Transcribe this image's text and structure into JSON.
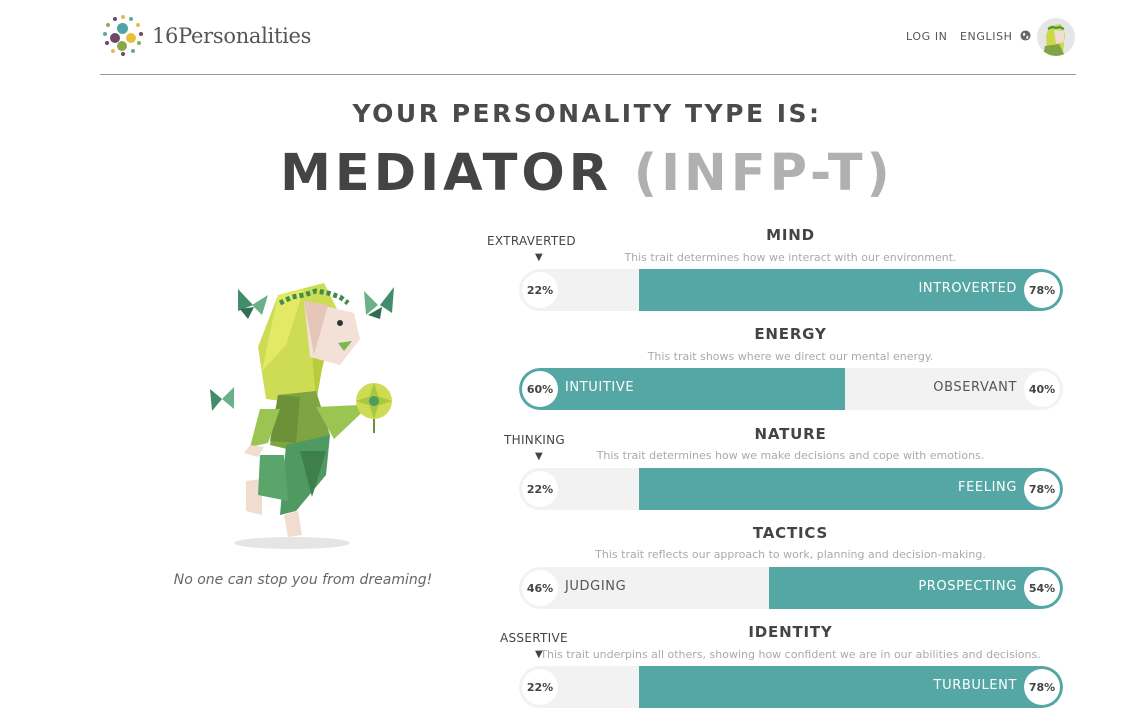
{
  "header": {
    "logo_text": "16Personalities",
    "login_label": "LOG IN",
    "language_label": "ENGLISH"
  },
  "result": {
    "headline": "YOUR PERSONALITY TYPE IS:",
    "type_name": "MEDIATOR",
    "type_code": "(INFP-T)",
    "quote": "No one can stop you from dreaming!"
  },
  "traits": [
    {
      "name": "MIND",
      "description": "This trait determines how we interact with our environment.",
      "pointer_label": "EXTRAVERTED",
      "left_pct": "22%",
      "right_pct": "78%",
      "left_label": "",
      "right_label": "INTROVERTED",
      "dominant": "right",
      "dominant_value": 78
    },
    {
      "name": "ENERGY",
      "description": "This trait shows where we direct our mental energy.",
      "pointer_label": "",
      "left_pct": "60%",
      "right_pct": "40%",
      "left_label": "INTUITIVE",
      "right_label": "OBSERVANT",
      "dominant": "left",
      "dominant_value": 60
    },
    {
      "name": "NATURE",
      "description": "This trait determines how we make decisions and cope with emotions.",
      "pointer_label": "THINKING",
      "left_pct": "22%",
      "right_pct": "78%",
      "left_label": "",
      "right_label": "FEELING",
      "dominant": "right",
      "dominant_value": 78
    },
    {
      "name": "TACTICS",
      "description": "This trait reflects our approach to work, planning and decision-making.",
      "pointer_label": "",
      "left_pct": "46%",
      "right_pct": "54%",
      "left_label": "JUDGING",
      "right_label": "PROSPECTING",
      "dominant": "right",
      "dominant_value": 54
    },
    {
      "name": "IDENTITY",
      "description": "This trait underpins all others, showing how confident we are in our abilities and decisions.",
      "pointer_label": "ASSERTIVE",
      "left_pct": "22%",
      "right_pct": "78%",
      "left_label": "",
      "right_label": "TURBULENT",
      "dominant": "right",
      "dominant_value": 78
    }
  ],
  "colors": {
    "accent": "#55a7a6",
    "bar_bg": "#f2f2f2"
  }
}
